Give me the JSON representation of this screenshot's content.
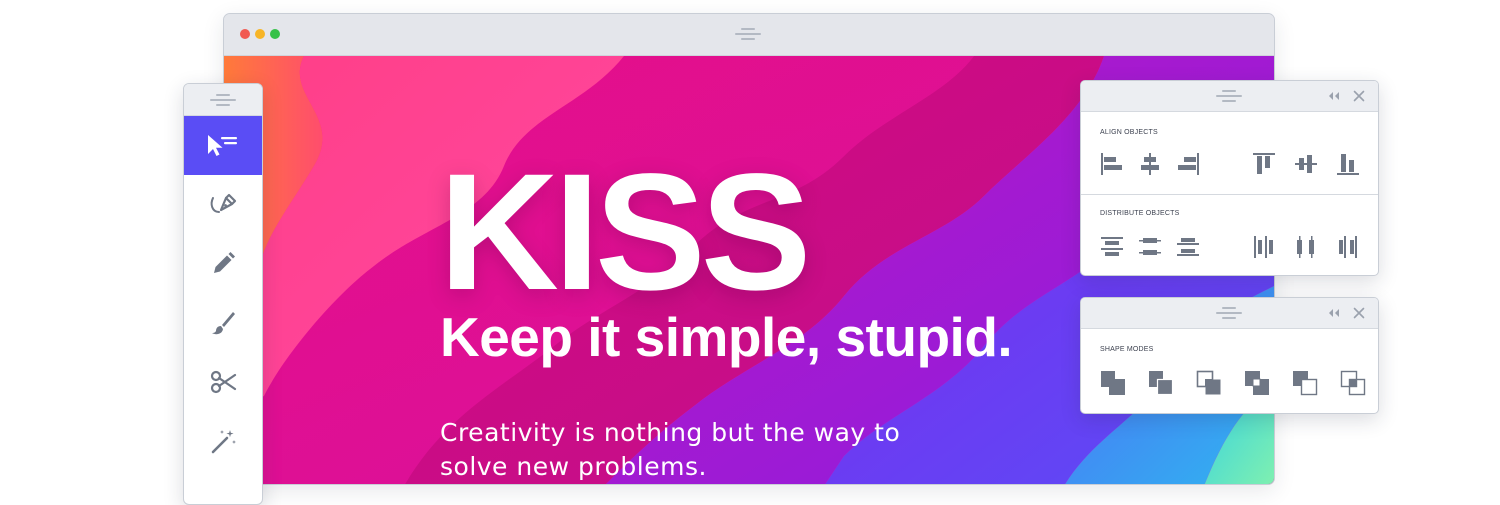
{
  "colors": {
    "accent": "#5a4df5",
    "icon_gray": "#6f7785",
    "traffic_red": "#f15a52",
    "traffic_yellow": "#f7b527",
    "traffic_green": "#35c148"
  },
  "hero": {
    "headline": "KISS",
    "subhead": "Keep it simple, stupid.",
    "body": "Creativity is nothing but the way to solve new problems."
  },
  "toolbar": {
    "tools": [
      {
        "icon": "selection-arrow-icon",
        "active": true
      },
      {
        "icon": "pen-tool-icon",
        "active": false
      },
      {
        "icon": "pencil-icon",
        "active": false
      },
      {
        "icon": "brush-icon",
        "active": false
      },
      {
        "icon": "scissors-icon",
        "active": false
      },
      {
        "icon": "magic-wand-icon",
        "active": false
      }
    ]
  },
  "align_panel": {
    "align_label": "ALIGN OBJECTS",
    "align_icons": [
      "align-left-icon",
      "align-horizontal-center-icon",
      "align-right-icon",
      "align-top-icon",
      "align-vertical-center-icon",
      "align-bottom-icon"
    ],
    "distribute_label": "DISTRIBUTE OBJECTS",
    "distribute_icons": [
      "distribute-top-icon",
      "distribute-vertical-center-icon",
      "distribute-bottom-icon",
      "distribute-left-icon",
      "distribute-horizontal-center-icon",
      "distribute-right-icon"
    ]
  },
  "shape_panel": {
    "label": "SHAPE MODES",
    "icons": [
      "unite-icon",
      "minus-front-icon",
      "intersect-icon",
      "exclude-icon",
      "minus-back-icon",
      "divide-icon"
    ]
  }
}
